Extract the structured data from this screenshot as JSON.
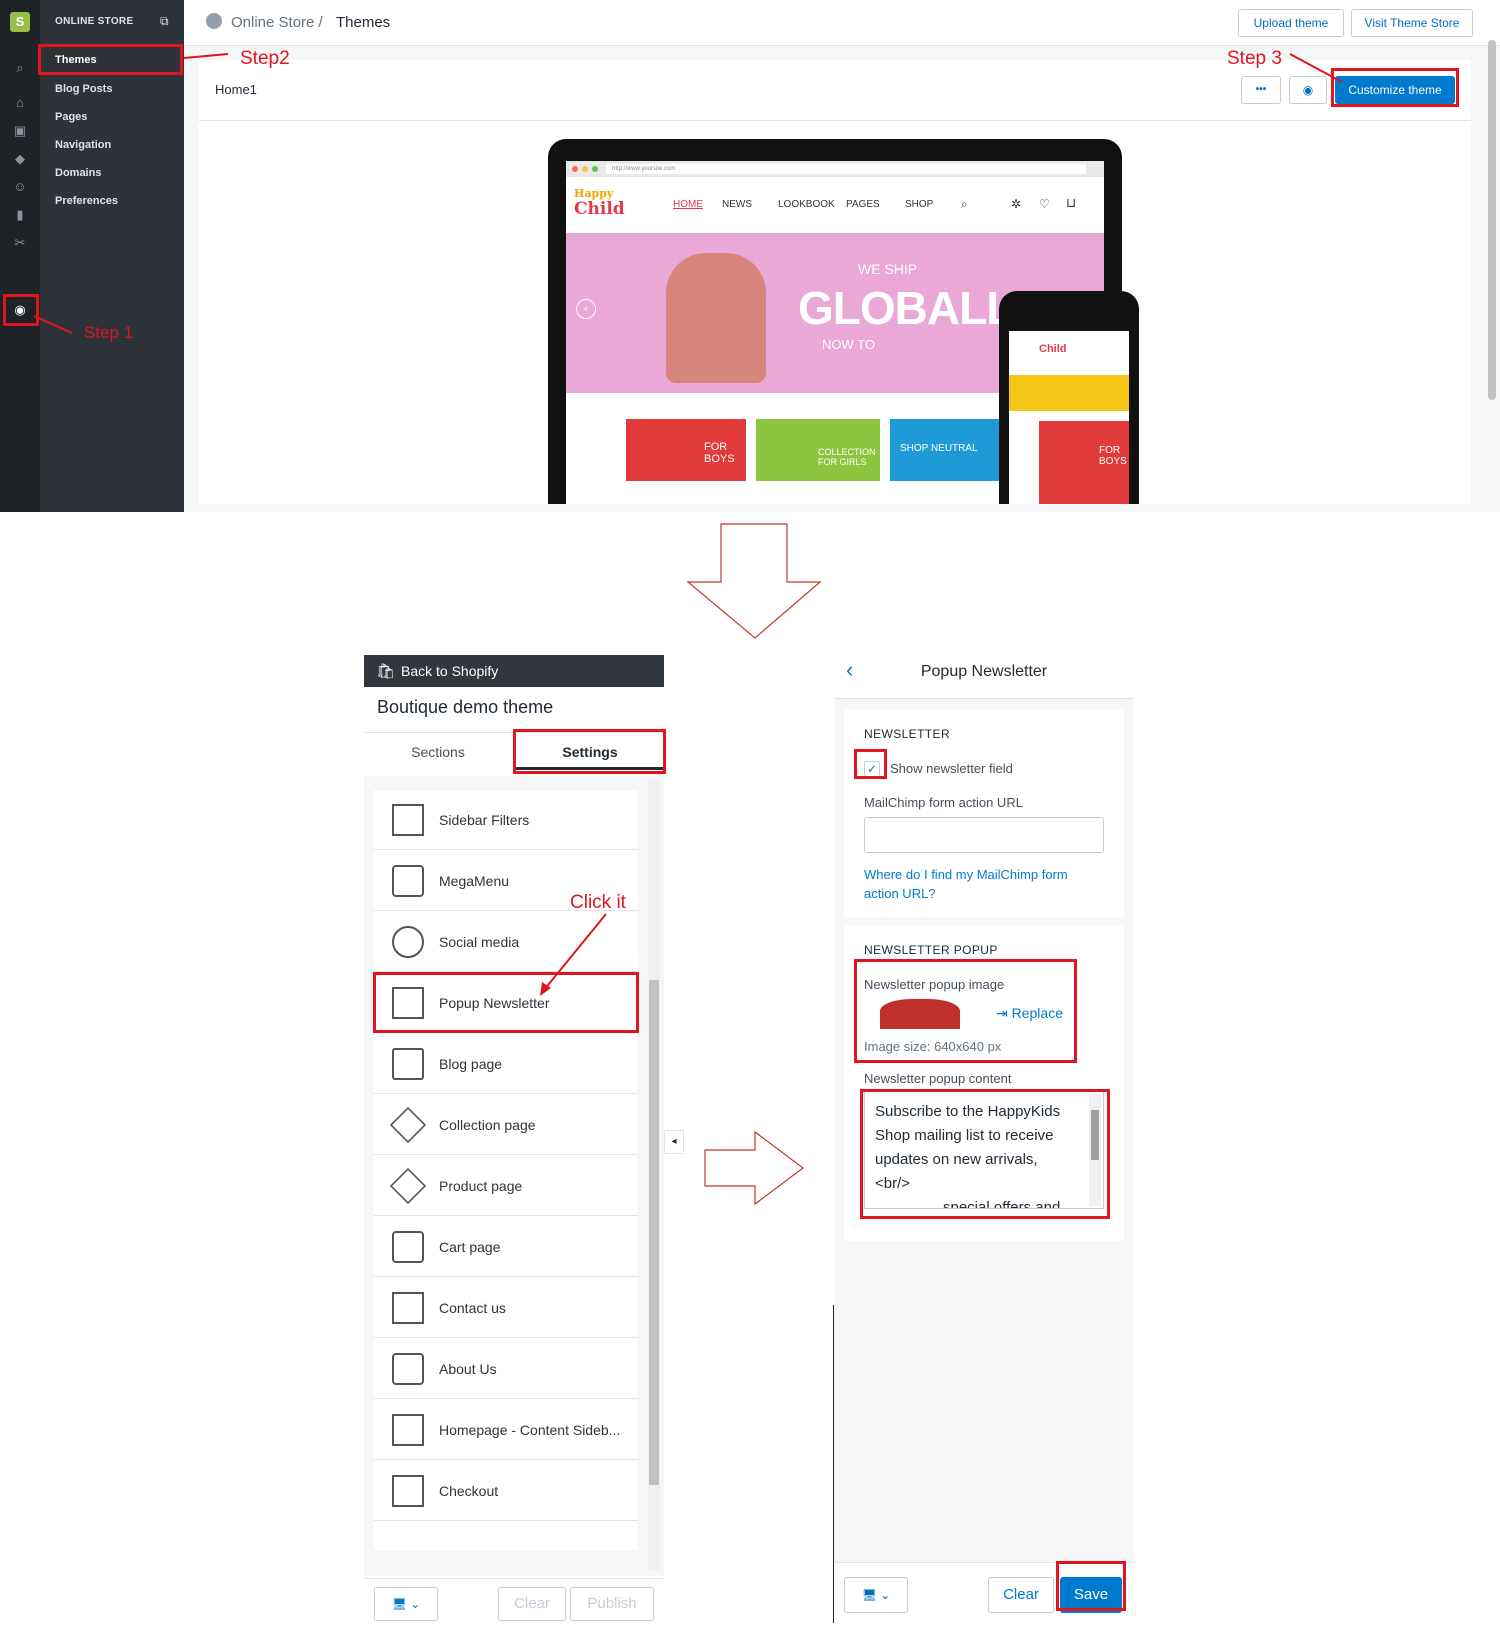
{
  "admin": {
    "store_label": "ONLINE STORE",
    "nav_items": [
      "Themes",
      "Blog Posts",
      "Pages",
      "Navigation",
      "Domains",
      "Preferences"
    ],
    "breadcrumb_root": "Online Store /",
    "breadcrumb_current": "Themes",
    "upload_theme": "Upload theme",
    "visit_store": "Visit Theme Store",
    "theme_name": "Home1",
    "more_label": "•••",
    "customize": "Customize theme"
  },
  "preview": {
    "url": "http://www.yoursite.com",
    "logo_top": "Happy",
    "logo_bottom": "Child",
    "menu": [
      "HOME",
      "NEWS",
      "LOOKBOOK",
      "PAGES",
      "SHOP"
    ],
    "banner_small": "WE SHIP",
    "banner_big": "GLOBALLY!",
    "banner_sub": "NOW TO",
    "tiles": [
      "FOR BOYS",
      "COLLECTION FOR GIRLS",
      "SHOP NEUTRAL",
      "FOR BOYS"
    ]
  },
  "annotations": {
    "step1": "Step 1",
    "step2": "Step2",
    "step3": "Step 3",
    "click": "Click it"
  },
  "customizer": {
    "back": "Back to Shopify",
    "theme": "Boutique demo theme",
    "tab_sections": "Sections",
    "tab_settings": "Settings",
    "items": [
      "Sidebar Filters",
      "MegaMenu",
      "Social media",
      "Popup Newsletter",
      "Blog page",
      "Collection page",
      "Product page",
      "Cart page",
      "Contact us",
      "About Us",
      "Homepage - Content Sideb...",
      "Checkout"
    ],
    "clear": "Clear",
    "publish": "Publish"
  },
  "popup": {
    "title": "Popup Newsletter",
    "newsletter_heading": "NEWSLETTER",
    "show_field": "Show newsletter field",
    "mailchimp_label": "MailChimp form action URL",
    "mailchimp_value": "",
    "help_link": "Where do I find my MailChimp form action URL?",
    "popup_heading": "NEWSLETTER POPUP",
    "image_label": "Newsletter popup image",
    "replace": "Replace",
    "image_size": "Image size: 640x640 px",
    "content_label": "Newsletter popup content",
    "content_lines": [
      "Subscribe to the HappyKids",
      "Shop mailing list to receive",
      "updates on new arrivals,",
      "<br/>",
      "special offers and"
    ],
    "clear": "Clear",
    "save": "Save"
  },
  "colors": {
    "accent": "#007ace",
    "highlight": "#e0151d",
    "sidebar": "#2e3339"
  }
}
